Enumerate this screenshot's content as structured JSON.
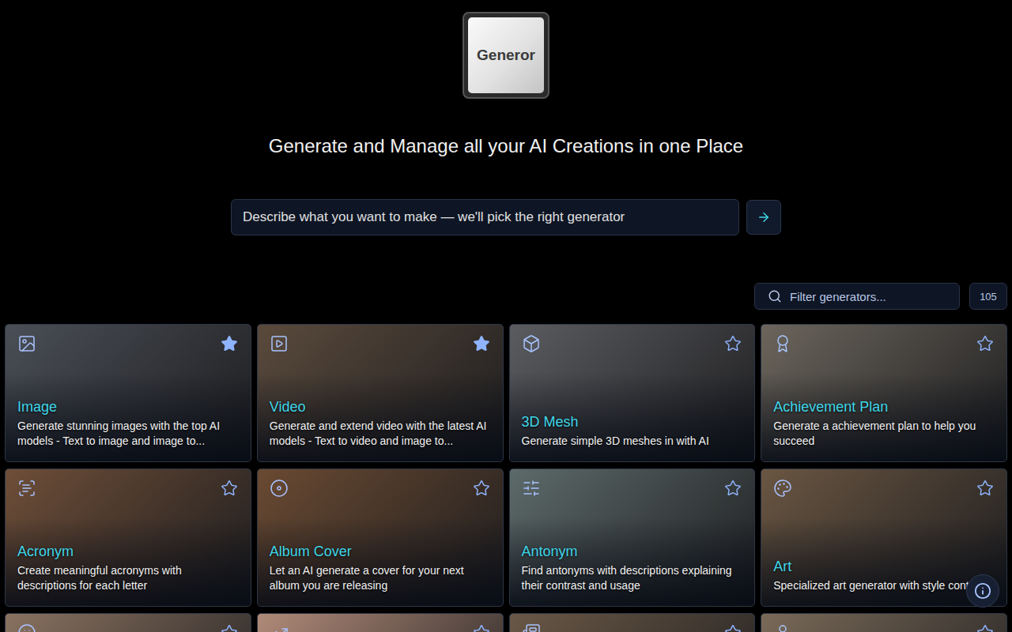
{
  "logo": {
    "text": "Generor"
  },
  "tagline": "Generate and Manage all your AI Creations in one Place",
  "prompt": {
    "placeholder": "Describe what you want to make — we'll pick the right generator"
  },
  "filter": {
    "placeholder": "Filter generators...",
    "count": "105"
  },
  "generators": [
    {
      "title": "Image",
      "description": "Generate stunning images with the top AI models - Text to image and image to...",
      "starred": true,
      "color": "#4a4e56"
    },
    {
      "title": "Video",
      "description": "Generate and extend video with the latest AI models - Text to video and image to...",
      "starred": true,
      "color": "#5a4a3c"
    },
    {
      "title": "3D Mesh",
      "description": "Generate simple 3D meshes in with AI",
      "starred": false,
      "color": "#5b5c60"
    },
    {
      "title": "Achievement Plan",
      "description": "Generate a achievement plan to help you succeed",
      "starred": false,
      "color": "#6b655c"
    },
    {
      "title": "Acronym",
      "description": "Create meaningful acronyms with descriptions for each letter",
      "starred": false,
      "color": "#6e4e38"
    },
    {
      "title": "Album Cover",
      "description": "Let an AI generate a cover for your next album you are releasing",
      "starred": false,
      "color": "#6a4a32"
    },
    {
      "title": "Antonym",
      "description": "Find antonyms with descriptions explaining their contrast and usage",
      "starred": false,
      "color": "#5d6a6a"
    },
    {
      "title": "Art",
      "description": "Specialized art generator with style controls",
      "starred": false,
      "color": "#6a5642"
    },
    {
      "starred": false,
      "color": "#8a7260"
    },
    {
      "starred": false,
      "color": "#b08a78"
    },
    {
      "starred": false,
      "color": "#6a5846"
    },
    {
      "starred": false,
      "color": "#7a6a58"
    }
  ]
}
